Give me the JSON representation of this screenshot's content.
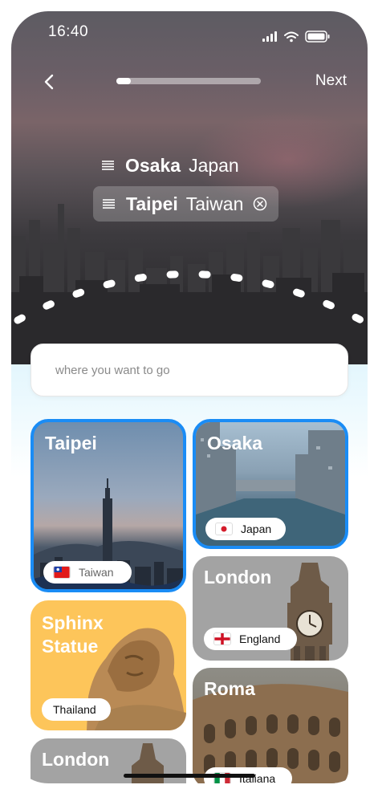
{
  "status_bar": {
    "time": "16:40"
  },
  "topbar": {
    "next_label": "Next",
    "progress": 0.1
  },
  "route": [
    {
      "city": "Osaka",
      "country": "Japan"
    },
    {
      "city": "Taipei",
      "country": "Taiwan"
    }
  ],
  "search": {
    "placeholder": "where you want to go",
    "value": ""
  },
  "cards": {
    "taipei": {
      "title": "Taipei",
      "country": "Taiwan"
    },
    "osaka": {
      "title": "Osaka",
      "country": "Japan"
    },
    "london": {
      "title": "London",
      "country": "England"
    },
    "sphinx": {
      "title_line1": "Sphinx",
      "title_line2": "Statue",
      "country": "Thailand"
    },
    "roma": {
      "title": "Roma",
      "country": "Italiana"
    },
    "london2": {
      "title": "London"
    }
  },
  "colors": {
    "selection_border": "#1a8cf5",
    "sphinx_bg": "#fdc55a",
    "gray_card": "#a3a3a3"
  }
}
